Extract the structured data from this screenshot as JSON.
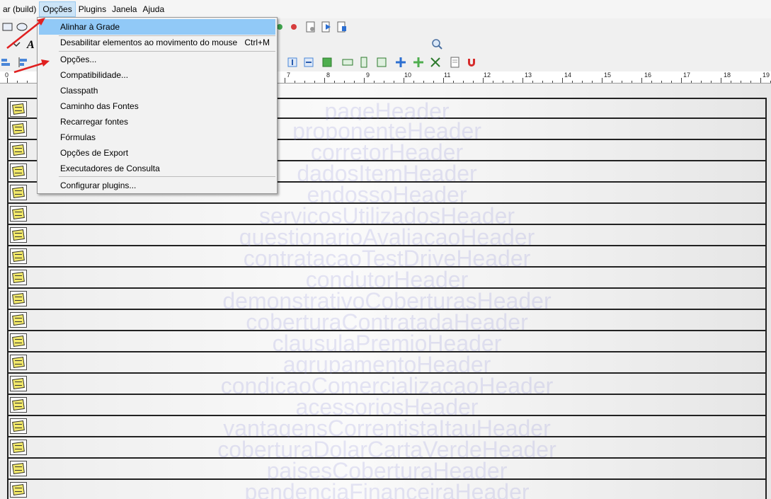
{
  "menubar": {
    "items": [
      "ar (build)",
      "Opções",
      "Plugins",
      "Janela",
      "Ajuda"
    ],
    "active_index": 1
  },
  "options_menu": {
    "items": [
      {
        "label": "Alinhar à Grade",
        "shortcut": ""
      },
      {
        "label": "Desabilitar elementos ao movimento do mouse",
        "shortcut": "Ctrl+M"
      },
      {
        "label": "Opções...",
        "shortcut": ""
      },
      {
        "label": "Compatibilidade...",
        "shortcut": ""
      },
      {
        "label": "Classpath",
        "shortcut": ""
      },
      {
        "label": "Caminho das Fontes",
        "shortcut": ""
      },
      {
        "label": "Recarregar fontes",
        "shortcut": ""
      },
      {
        "label": "Fórmulas",
        "shortcut": ""
      },
      {
        "label": "Opções de Export",
        "shortcut": ""
      },
      {
        "label": "Executadores de Consulta",
        "shortcut": ""
      },
      {
        "label": "Configurar plugins...",
        "shortcut": ""
      }
    ],
    "highlighted_index": 0
  },
  "ruler": {
    "labels": [
      "0",
      "7",
      "8",
      "9",
      "10",
      "11",
      "12",
      "13",
      "14",
      "15",
      "16",
      "17",
      "18",
      "19"
    ]
  },
  "bands": [
    "pageHeader",
    "proponenteHeader",
    "corretorHeader",
    "dadosItemHeader",
    "endossoHeader",
    "servicosUtilizadosHeader",
    "questionarioAvaliacaoHeader",
    "contratacaoTestDriveHeader",
    "condutorHeader",
    "demonstrativoCoberturasHeader",
    "coberturaContratadaHeader",
    "clausulaPremioHeader",
    "agrupamentoHeader",
    "condicaoComercializacaoHeader",
    "acessoriosHeader",
    "vantagensCorrentistaItauHeader",
    "coberturaDolarCartaVerdeHeader",
    "paisesCoberturaHeader",
    "pendenciaFinanceiraHeader"
  ],
  "colors": {
    "menu_highlight": "#91c9f7",
    "annotation_arrow": "#e02020",
    "band_label": "#7878d2"
  }
}
